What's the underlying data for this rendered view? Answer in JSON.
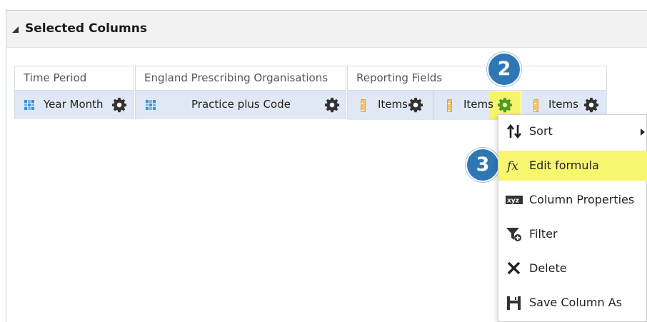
{
  "section": {
    "title": "Selected Columns"
  },
  "groups": [
    {
      "title": "Time Period",
      "columns": [
        {
          "label": "Year Month",
          "icon": "attribute-grid-icon"
        }
      ]
    },
    {
      "title": "England Prescribing Organisations",
      "columns": [
        {
          "label": "Practice plus Code",
          "icon": "attribute-grid-icon"
        }
      ]
    },
    {
      "title": "Reporting Fields",
      "columns": [
        {
          "label": "Items",
          "icon": "measure-ruler-icon"
        },
        {
          "label": "Items",
          "icon": "measure-ruler-icon"
        },
        {
          "label": "Items",
          "icon": "measure-ruler-icon"
        }
      ]
    }
  ],
  "badges": {
    "step2": "2",
    "step3": "3"
  },
  "menu": {
    "items": [
      {
        "label": "Sort",
        "icon": "sort-icon",
        "has_submenu": true
      },
      {
        "label": "Edit formula",
        "icon": "fx-icon",
        "highlighted": true
      },
      {
        "label": "Column Properties",
        "icon": "xyz-icon"
      },
      {
        "label": "Filter",
        "icon": "filter-icon"
      },
      {
        "label": "Delete",
        "icon": "delete-x-icon"
      },
      {
        "label": "Save Column As",
        "icon": "save-icon"
      }
    ]
  },
  "colors": {
    "badge": "#2f77b4",
    "highlight": "#f8f56f",
    "column_row": "#dfe8f4",
    "gear_active": "#4a9b2c",
    "gear_default": "#333333"
  }
}
